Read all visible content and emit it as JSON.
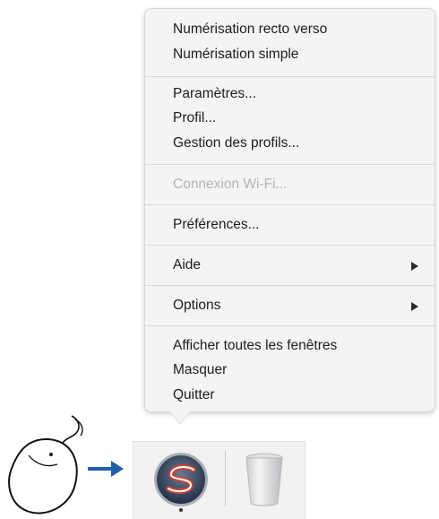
{
  "menu": {
    "items": [
      {
        "label": "Numérisation recto verso",
        "enabled": true
      },
      {
        "label": "Numérisation simple",
        "enabled": true
      },
      {
        "label": "Paramètres...",
        "enabled": true
      },
      {
        "label": "Profil...",
        "enabled": true
      },
      {
        "label": "Gestion des profils...",
        "enabled": true
      },
      {
        "label": "Connexion Wi-Fi...",
        "enabled": false
      },
      {
        "label": "Préférences...",
        "enabled": true
      },
      {
        "label": "Aide",
        "enabled": true,
        "submenu": true
      },
      {
        "label": "Options",
        "enabled": true,
        "submenu": true
      },
      {
        "label": "Afficher toutes les fenêtres",
        "enabled": true
      },
      {
        "label": "Masquer",
        "enabled": true
      },
      {
        "label": "Quitter",
        "enabled": true
      }
    ]
  },
  "dock": {
    "apps": [
      {
        "icon": "scansnap-app-icon",
        "running": true
      },
      {
        "icon": "trash-icon",
        "running": false
      }
    ]
  },
  "annotation": {
    "mouse_icon": "mouse-icon",
    "arrow_icon": "arrow-right-icon",
    "arrow_color": "#1f5fa8"
  },
  "colors": {
    "menu_background": "#f4f4f4",
    "disabled_text": "#b4b4b4",
    "separator": "#d9d9d9"
  }
}
